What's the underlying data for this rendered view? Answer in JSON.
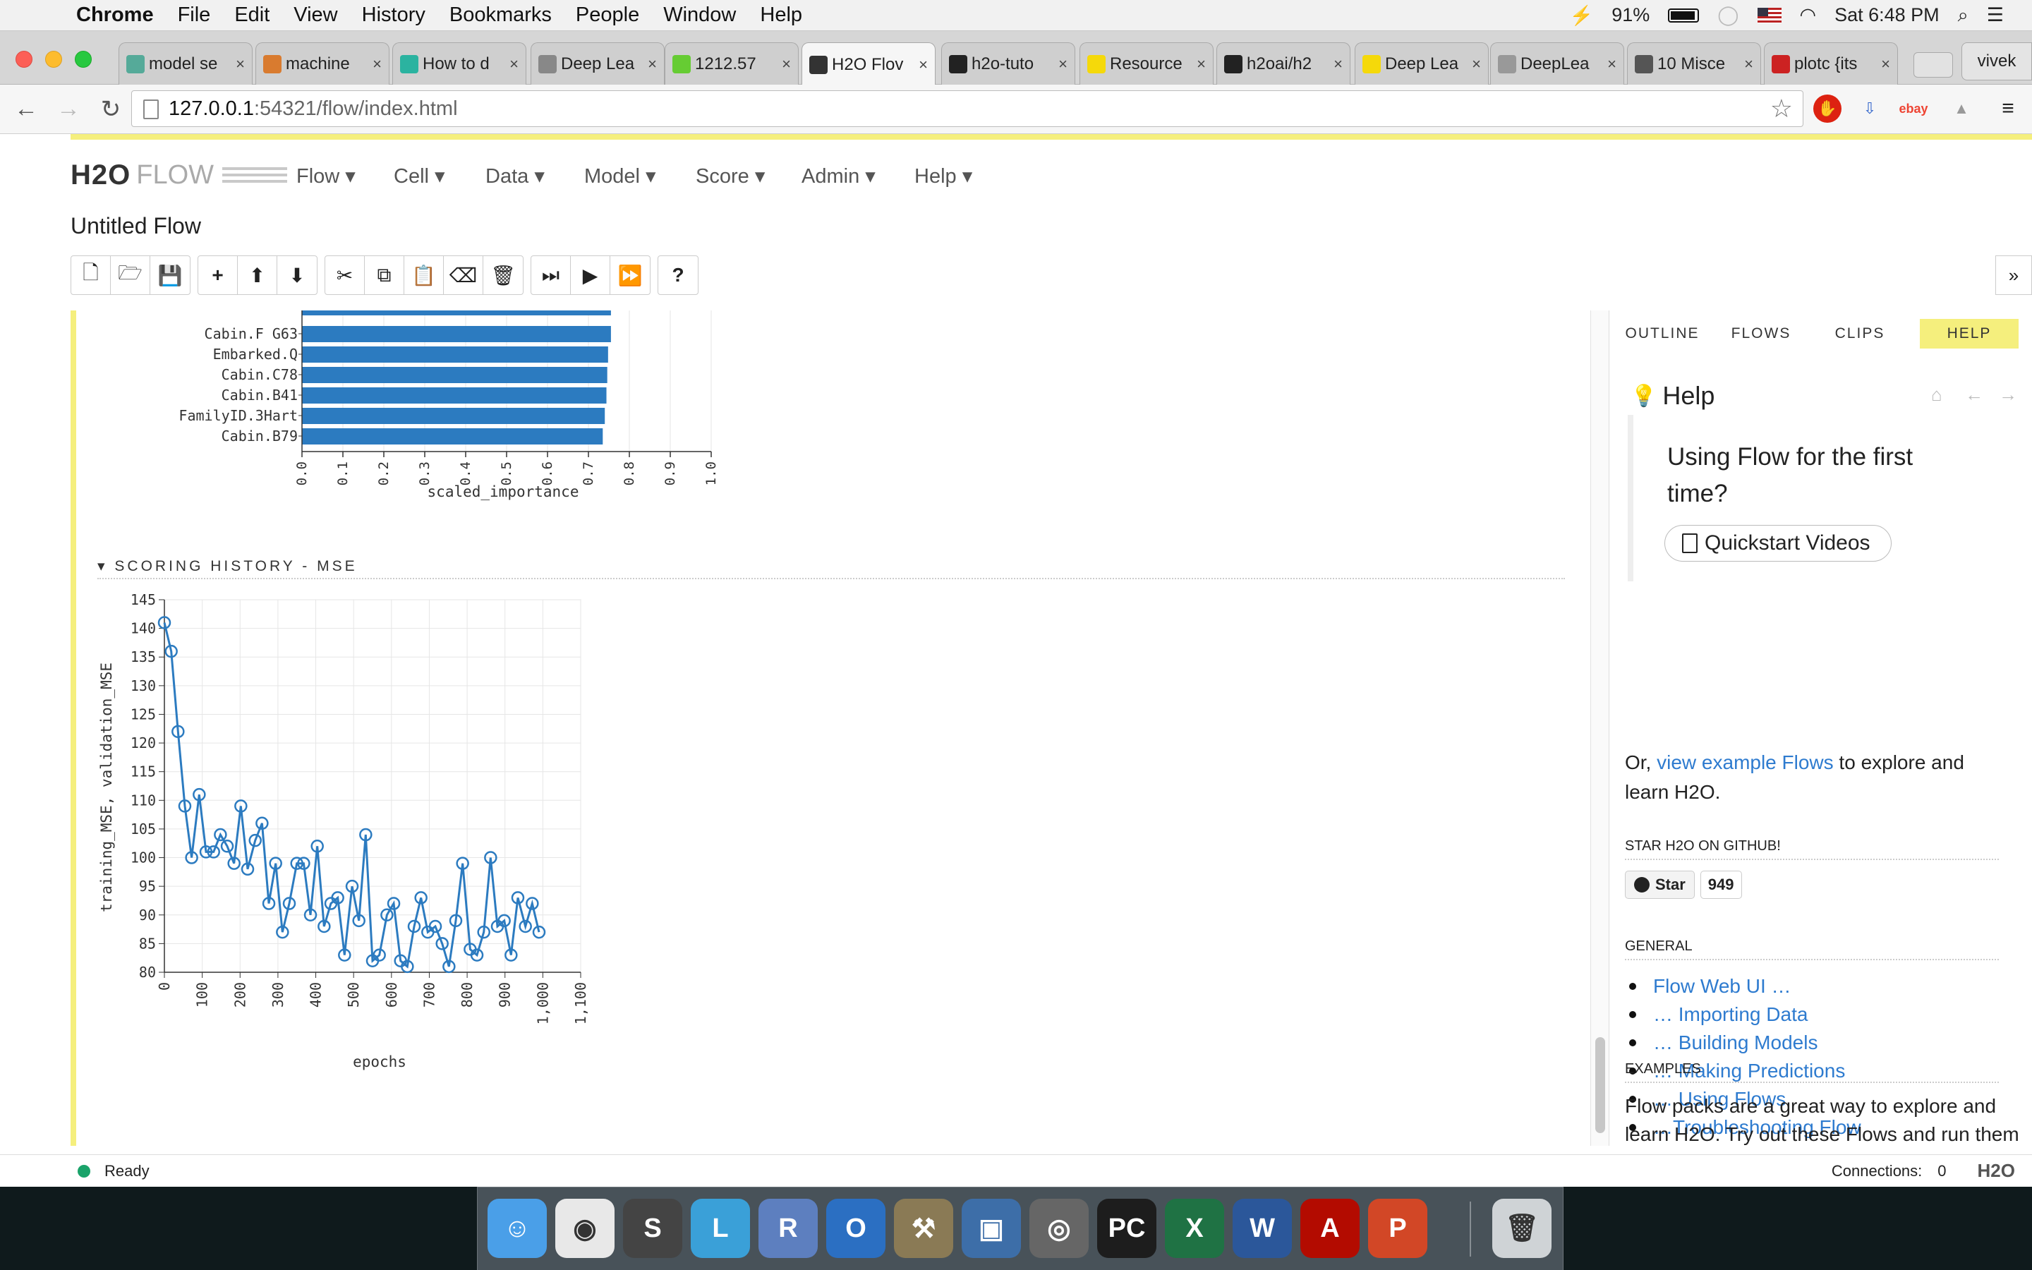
{
  "menubar": {
    "app": "Chrome",
    "items": [
      "File",
      "Edit",
      "View",
      "History",
      "Bookmarks",
      "People",
      "Window",
      "Help"
    ],
    "battery": "91%",
    "clock": "Sat 6:48 PM"
  },
  "tabs": [
    {
      "label": "model se",
      "fav": "#5a9"
    },
    {
      "label": "machine",
      "fav": "#d97b2f"
    },
    {
      "label": "How to d",
      "fav": "#2bb3a0"
    },
    {
      "label": "Deep Lea",
      "fav": "#888"
    },
    {
      "label": "1212.57",
      "fav": "#6c3"
    },
    {
      "label": "H2O Flov",
      "fav": "#333",
      "active": true
    },
    {
      "label": "h2o-tuto",
      "fav": "#222"
    },
    {
      "label": "Resource",
      "fav": "#f5d90a"
    },
    {
      "label": "h2oai/h2",
      "fav": "#222"
    },
    {
      "label": "Deep Lea",
      "fav": "#f5d90a"
    },
    {
      "label": "DeepLea",
      "fav": "#999"
    },
    {
      "label": "10 Misce",
      "fav": "#555"
    },
    {
      "label": "plotc {its",
      "fav": "#c22"
    }
  ],
  "profile": "vivek",
  "url": {
    "host": "127.0.0.1",
    "rest": ":54321/flow/index.html"
  },
  "app": {
    "logo_h2o": "H2O",
    "logo_flow": "FLOW",
    "nav": [
      "Flow",
      "Cell",
      "Data",
      "Model",
      "Score",
      "Admin",
      "Help"
    ],
    "title": "Untitled Flow"
  },
  "importance_chart": {
    "labels": [
      "Cabin.F G63",
      "Embarked.Q",
      "Cabin.C78",
      "Cabin.B41",
      "FamilyID.3Hart",
      "Cabin.B79"
    ],
    "xlabel": "scaled_importance",
    "ticks": [
      "0.0",
      "0.1",
      "0.2",
      "0.3",
      "0.4",
      "0.5",
      "0.6",
      "0.7",
      "0.8",
      "0.9",
      "1.0"
    ]
  },
  "section_title": "SCORING HISTORY - MSE",
  "chart_data": [
    {
      "type": "bar",
      "orientation": "horizontal",
      "categories": [
        "Cabin.F G63",
        "Embarked.Q",
        "Cabin.C78",
        "Cabin.B41",
        "FamilyID.3Hart",
        "Cabin.B79"
      ],
      "values": [
        0.755,
        0.748,
        0.746,
        0.744,
        0.74,
        0.735
      ],
      "xlabel": "scaled_importance",
      "xlim": [
        0,
        1
      ]
    },
    {
      "type": "line",
      "xlabel": "epochs",
      "ylabel": "training_MSE, validation_MSE",
      "xlim": [
        0,
        1100
      ],
      "ylim": [
        80,
        145
      ],
      "x": [
        0,
        18,
        36,
        54,
        72,
        92,
        110,
        130,
        148,
        166,
        184,
        202,
        220,
        240,
        258,
        276,
        294,
        312,
        330,
        350,
        368,
        386,
        404,
        422,
        440,
        458,
        476,
        496,
        514,
        532,
        550,
        568,
        588,
        606,
        624,
        642,
        660,
        678,
        696,
        716,
        734,
        752,
        770,
        788,
        808,
        826,
        844,
        862,
        880,
        898,
        916,
        934,
        954,
        972,
        990
      ],
      "y": [
        141,
        136,
        122,
        109,
        100,
        111,
        101,
        101,
        104,
        102,
        99,
        109,
        98,
        103,
        106,
        92,
        99,
        87,
        92,
        99,
        99,
        90,
        102,
        88,
        92,
        93,
        83,
        95,
        89,
        104,
        82,
        83,
        90,
        92,
        82,
        81,
        88,
        93,
        87,
        88,
        85,
        81,
        89,
        99,
        84,
        83,
        87,
        100,
        88,
        89,
        83,
        93,
        88,
        92,
        87
      ]
    }
  ],
  "sidebar": {
    "tabs": [
      "OUTLINE",
      "FLOWS",
      "CLIPS",
      "HELP"
    ],
    "help_title": "Help",
    "quickstart_title": "Using Flow for the first time?",
    "quickstart_btn": "Quickstart Videos",
    "or_prefix": "Or, ",
    "or_link": "view example Flows",
    "or_suffix": " to explore and learn H2O.",
    "github_head": "STAR H2O ON GITHUB!",
    "star_label": "Star",
    "star_count": "949",
    "general_head": "GENERAL",
    "general_links": [
      "Flow Web UI …",
      "… Importing Data",
      "… Building Models",
      "… Making Predictions",
      "… Using Flows",
      "…Troubleshooting Flow"
    ],
    "examples_head": "EXAMPLES",
    "examples_text": "Flow packs are a great way to explore and learn H2O. Try out these Flows and run them in your browser."
  },
  "status": {
    "text": "Ready",
    "connections_label": "Connections:",
    "connections": "0",
    "logo": "H2O"
  },
  "dock": [
    {
      "name": "finder",
      "bg": "#4a9fe8",
      "glyph": "☺"
    },
    {
      "name": "chrome",
      "bg": "#e8e8e8",
      "glyph": "◉"
    },
    {
      "name": "sublime",
      "bg": "#444",
      "glyph": "S"
    },
    {
      "name": "launchpad",
      "bg": "#3aa0d8",
      "glyph": "L"
    },
    {
      "name": "r",
      "bg": "#5d7fbf",
      "glyph": "R"
    },
    {
      "name": "outlook",
      "bg": "#2b6fc2",
      "glyph": "O"
    },
    {
      "name": "tools",
      "bg": "#8a7a55",
      "glyph": "⚒"
    },
    {
      "name": "virtualbox",
      "bg": "#3d6ea8",
      "glyph": "▣"
    },
    {
      "name": "dashboard",
      "bg": "#666",
      "glyph": "◎"
    },
    {
      "name": "pycharm",
      "bg": "#1d1d1d",
      "glyph": "PC"
    },
    {
      "name": "excel",
      "bg": "#1f7244",
      "glyph": "X"
    },
    {
      "name": "word",
      "bg": "#2b579a",
      "glyph": "W"
    },
    {
      "name": "acrobat",
      "bg": "#b30b00",
      "glyph": "A"
    },
    {
      "name": "powerpoint",
      "bg": "#d24726",
      "glyph": "P"
    },
    {
      "name": "trash",
      "bg": "#cfd3d6",
      "glyph": "🗑"
    }
  ]
}
